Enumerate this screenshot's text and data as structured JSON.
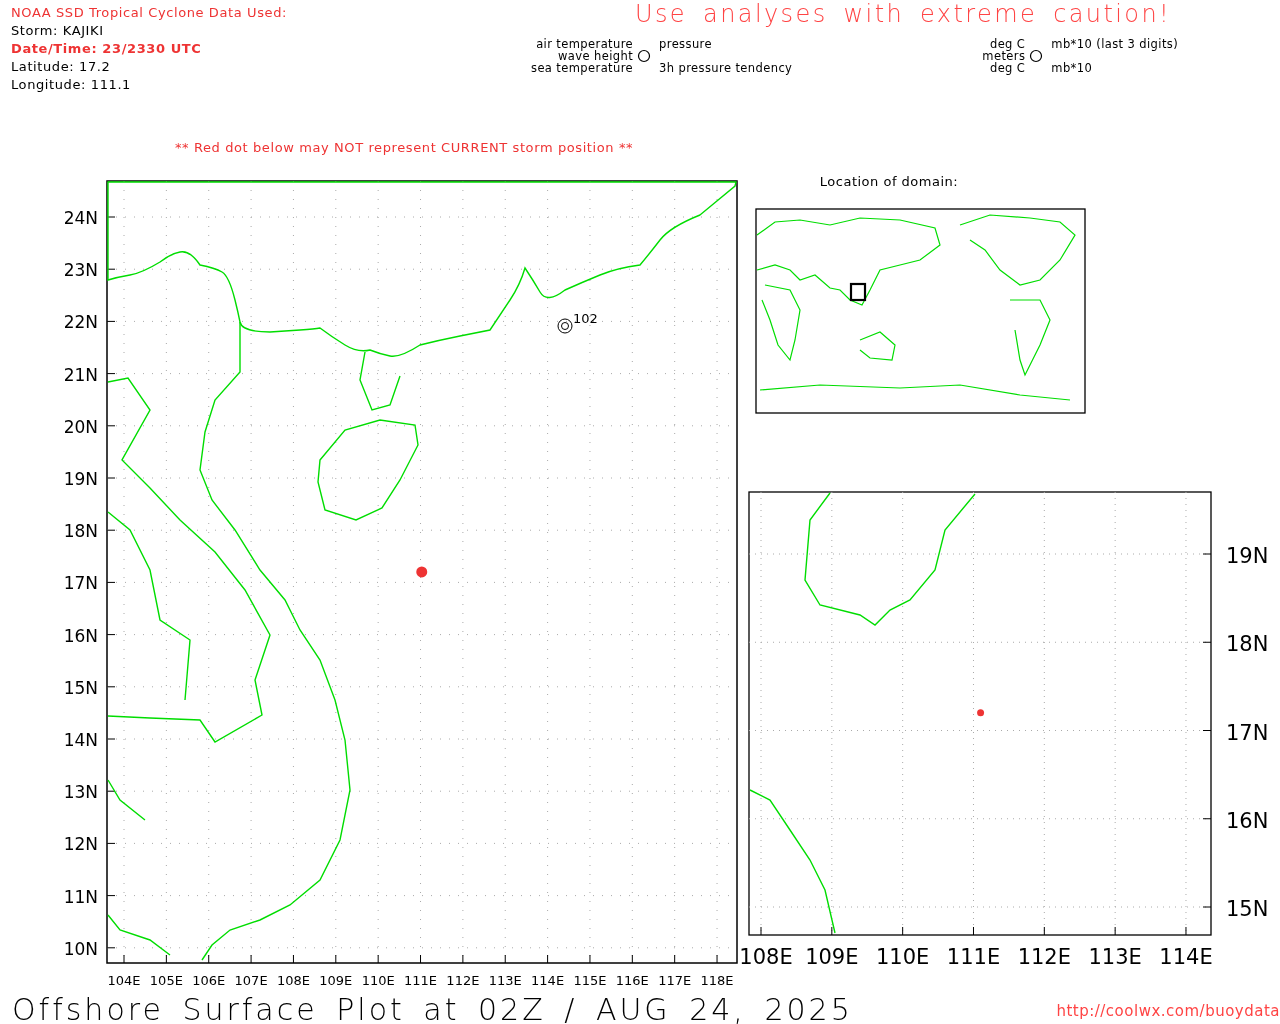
{
  "header": {
    "source_title": "NOAA SSD Tropical Cyclone Data Used:",
    "storm": "Storm: KAJIKI",
    "date_time": "Date/Time: 23/2330 UTC",
    "latitude": {
      "label": "Latitude:",
      "value": "17.2"
    },
    "longitude": {
      "label": "Longitude:",
      "value": "111.1"
    }
  },
  "caution": "Use analyses with extreme caution!",
  "legend_left": {
    "top_left": "air temperature",
    "middle_left": "wave height",
    "bottom_left": "sea temperature",
    "top_right": "pressure",
    "bottom_right": "3h pressure tendency"
  },
  "legend_right": {
    "top_left": "deg C",
    "middle_left": "meters",
    "bottom_left": "deg C",
    "top_right": "mb*10 (last 3 digits)",
    "bottom_right": "mb*10"
  },
  "note": "** Red dot below may NOT represent CURRENT storm position **",
  "main_map": {
    "lat_labels": [
      "24N",
      "23N",
      "22N",
      "21N",
      "20N",
      "19N",
      "18N",
      "17N",
      "16N",
      "15N",
      "14N",
      "13N",
      "12N",
      "11N",
      "10N"
    ],
    "lon_labels": [
      "104E",
      "105E",
      "106E",
      "107E",
      "108E",
      "109E",
      "110E",
      "111E",
      "112E",
      "113E",
      "114E",
      "115E",
      "116E",
      "117E",
      "118E"
    ],
    "station_label": "102"
  },
  "domain_map": {
    "title": "Location of domain:"
  },
  "zoom_map": {
    "lat_labels": [
      "19N",
      "18N",
      "17N",
      "16N",
      "15N"
    ],
    "lon_labels": [
      "108E",
      "109E",
      "110E",
      "111E",
      "112E",
      "113E",
      "114E"
    ]
  },
  "footer": {
    "title": "Offshore Surface Plot at 02Z / AUG 24, 2025",
    "url": "http://coolwx.com/buoydata"
  }
}
